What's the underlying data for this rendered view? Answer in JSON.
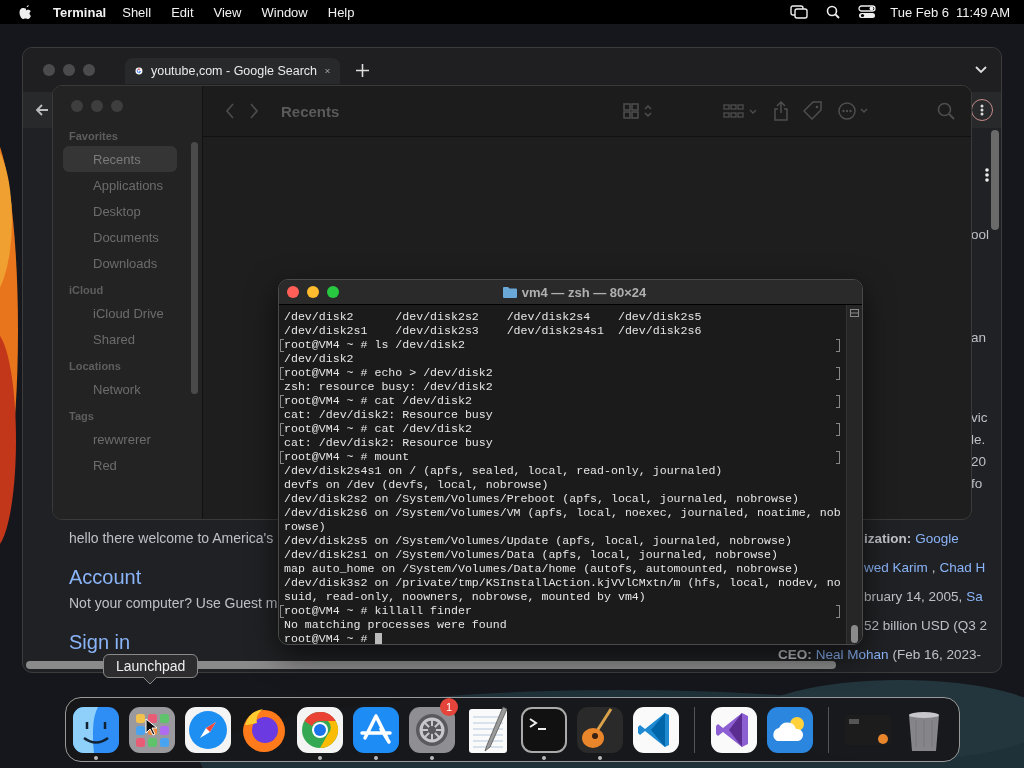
{
  "menu_bar": {
    "app": "Terminal",
    "menus": [
      "Shell",
      "Edit",
      "View",
      "Window",
      "Help"
    ],
    "date": "Tue Feb 6",
    "time": "11:49 AM"
  },
  "browser": {
    "tab_title": "youtube,com - Google Search",
    "intro": "hello there welcome to America's",
    "sections": [
      {
        "heading": "Account",
        "text": "Not your computer? Use Guest m"
      },
      {
        "heading": "Sign in"
      }
    ],
    "fragments": [
      "ool",
      "an",
      "vic",
      "le.",
      "20",
      "fo"
    ],
    "infobox": [
      [
        {
          "text": "ization:",
          "kind": "bold"
        },
        {
          "text": "Google",
          "kind": "link"
        }
      ],
      [
        {
          "text": "wed Karim",
          "kind": "link"
        },
        {
          "text": ",",
          "kind": "plain"
        },
        {
          "text": "Chad H",
          "kind": "link"
        }
      ],
      [
        {
          "text": "bruary 14, 2005,",
          "kind": "plain"
        },
        {
          "text": "Sa",
          "kind": "link"
        }
      ],
      [
        {
          "text": "52 billion USD (Q3 2",
          "kind": "plain"
        }
      ],
      [
        {
          "text": "CEO:",
          "kind": "bold"
        },
        {
          "text": "Neal Mohan",
          "kind": "link"
        },
        {
          "text": "(Feb 16, 2023-",
          "kind": "plain"
        }
      ]
    ]
  },
  "finder": {
    "title": "Recents",
    "sidebar": [
      {
        "heading": "Favorites",
        "items": [
          {
            "label": "Recents",
            "selected": true
          },
          {
            "label": "Applications",
            "selected": false
          },
          {
            "label": "Desktop",
            "selected": false
          },
          {
            "label": "Documents",
            "selected": false
          },
          {
            "label": "Downloads",
            "selected": false
          }
        ]
      },
      {
        "heading": "iCloud",
        "items": [
          {
            "label": "iCloud Drive",
            "selected": false
          },
          {
            "label": "Shared",
            "selected": false
          }
        ]
      },
      {
        "heading": "Locations",
        "items": [
          {
            "label": "Network",
            "selected": false
          }
        ]
      },
      {
        "heading": "Tags",
        "items": [
          {
            "label": "rewwrerer",
            "selected": false
          },
          {
            "label": "Red",
            "selected": false
          }
        ]
      }
    ]
  },
  "terminal": {
    "title": "vm4 — zsh — 80×24",
    "lines": [
      {
        "kind": "output",
        "text": "/dev/disk2      /dev/disk2s2    /dev/disk2s4    /dev/disk2s5"
      },
      {
        "kind": "output",
        "text": "/dev/disk2s1    /dev/disk2s3    /dev/disk2s4s1  /dev/disk2s6"
      },
      {
        "kind": "prompt",
        "text": "root@VM4 ~ # ls /dev/disk2"
      },
      {
        "kind": "output",
        "text": "/dev/disk2"
      },
      {
        "kind": "prompt",
        "text": "root@VM4 ~ # echo > /dev/disk2"
      },
      {
        "kind": "output",
        "text": "zsh: resource busy: /dev/disk2"
      },
      {
        "kind": "prompt",
        "text": "root@VM4 ~ # cat /dev/disk2"
      },
      {
        "kind": "output",
        "text": "cat: /dev/disk2: Resource busy"
      },
      {
        "kind": "prompt",
        "text": "root@VM4 ~ # cat /dev/disk2"
      },
      {
        "kind": "output",
        "text": "cat: /dev/disk2: Resource busy"
      },
      {
        "kind": "prompt",
        "text": "root@VM4 ~ # mount"
      },
      {
        "kind": "output",
        "text": "/dev/disk2s4s1 on / (apfs, sealed, local, read-only, journaled)"
      },
      {
        "kind": "output",
        "text": "devfs on /dev (devfs, local, nobrowse)"
      },
      {
        "kind": "output",
        "text": "/dev/disk2s2 on /System/Volumes/Preboot (apfs, local, journaled, nobrowse)"
      },
      {
        "kind": "output",
        "text": "/dev/disk2s6 on /System/Volumes/VM (apfs, local, noexec, journaled, noatime, nob"
      },
      {
        "kind": "output",
        "text": "rowse)"
      },
      {
        "kind": "output",
        "text": "/dev/disk2s5 on /System/Volumes/Update (apfs, local, journaled, nobrowse)"
      },
      {
        "kind": "output",
        "text": "/dev/disk2s1 on /System/Volumes/Data (apfs, local, journaled, nobrowse)"
      },
      {
        "kind": "output",
        "text": "map auto_home on /System/Volumes/Data/home (autofs, automounted, nobrowse)"
      },
      {
        "kind": "output",
        "text": "/dev/disk3s2 on /private/tmp/KSInstallAction.kjVVlCMxtn/m (hfs, local, nodev, no"
      },
      {
        "kind": "output",
        "text": "suid, read-only, noowners, nobrowse, mounted by vm4)"
      },
      {
        "kind": "prompt",
        "text": "root@VM4 ~ # killall finder"
      },
      {
        "kind": "output",
        "text": "No matching processes were found"
      },
      {
        "kind": "current",
        "text": "root@VM4 ~ #"
      }
    ]
  },
  "dock": {
    "tooltip": "Launchpad",
    "items": [
      {
        "kind": "finder",
        "running": true
      },
      {
        "kind": "launchpad",
        "running": false
      },
      {
        "kind": "safari",
        "running": false
      },
      {
        "kind": "firefox",
        "running": false
      },
      {
        "kind": "chrome",
        "running": true
      },
      {
        "kind": "appstore",
        "running": true
      },
      {
        "kind": "settings",
        "running": true,
        "badge": "1"
      },
      {
        "kind": "textedit",
        "running": false
      },
      {
        "kind": "terminal",
        "running": true
      },
      {
        "kind": "garageband",
        "running": true
      },
      {
        "kind": "vscode",
        "running": false
      },
      {
        "kind": "separator"
      },
      {
        "kind": "visualstudio",
        "running": false
      },
      {
        "kind": "weather",
        "running": false
      },
      {
        "kind": "separator"
      },
      {
        "kind": "window",
        "running": false
      },
      {
        "kind": "trash",
        "running": false
      }
    ]
  }
}
